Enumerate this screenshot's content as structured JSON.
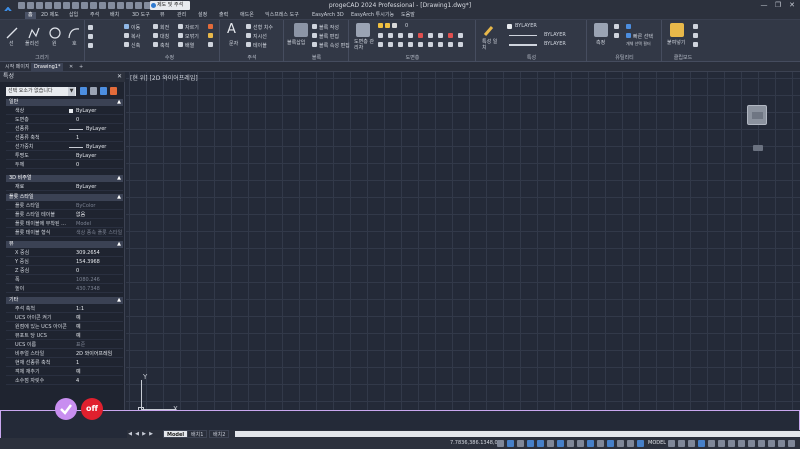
{
  "window": {
    "title": "progeCAD 2024 Professional - [Drawing1.dwg*]",
    "workspace": "제도 및 주석",
    "controls": [
      "—",
      "❐",
      "✕"
    ]
  },
  "menu": {
    "items": [
      "홈",
      "2D 제도",
      "삽입",
      "주석",
      "배치",
      "3D 도구",
      "뷰",
      "관리",
      "설정",
      "출력",
      "애드온",
      "익스프레스 도구",
      "EasyArch 3D",
      "EasyArch 투시기능",
      "도움말"
    ],
    "active": "홈"
  },
  "ribbon": {
    "draw": {
      "label": "그리기",
      "buttons": [
        "선",
        "폴리선",
        "원",
        "호"
      ]
    },
    "modify": {
      "label": "수정",
      "buttons": [
        "이동",
        "회전",
        "자르기",
        "복사",
        "대칭",
        "모깎기",
        "신축",
        "축척",
        "배열"
      ]
    },
    "annotation": {
      "label": "주석",
      "text_label": "문자",
      "buttons": [
        "선형 치수",
        "지시선",
        "테이블"
      ]
    },
    "block": {
      "label": "블록",
      "buttons": [
        "블록삽입",
        "블록 작성",
        "블록 편집",
        "블록 속성 편집"
      ]
    },
    "layers": {
      "label": "도면층",
      "manager_label": "도면층 관리자",
      "current_layer": "0"
    },
    "properties": {
      "label": "특성",
      "match_label": "특성 일치",
      "color": "BYLAYER",
      "linetype": "BYLAYER",
      "lineweight": "BYLAYER"
    },
    "utilities": {
      "label": "유틸리티",
      "buttons": [
        "측정",
        "빠른 선택",
        "개체 선택 필터"
      ]
    },
    "clipboard": {
      "label": "클립보드",
      "paste_label": "붙여넣기"
    }
  },
  "doc_tabs": [
    "시작 페이지",
    "Drawing1*"
  ],
  "properties_palette": {
    "title": "특성",
    "selection": "선택 요소가 없습니다",
    "sections": [
      {
        "name": "일반",
        "rows": [
          {
            "k": "색상",
            "v": "ByLayer",
            "swatch": true
          },
          {
            "k": "도면층",
            "v": "0"
          },
          {
            "k": "선종류",
            "v": "ByLayer",
            "line": true
          },
          {
            "k": "선종류 축척",
            "v": "1"
          },
          {
            "k": "선가중치",
            "v": "ByLayer",
            "line": true
          },
          {
            "k": "투명도",
            "v": "ByLayer"
          },
          {
            "k": "두께",
            "v": "0"
          }
        ]
      },
      {
        "name": "3D 비주얼",
        "rows": [
          {
            "k": "재료",
            "v": "ByLayer"
          }
        ]
      },
      {
        "name": "플롯 스타일",
        "rows": [
          {
            "k": "플롯 스타일",
            "v": "ByColor",
            "dim": true
          },
          {
            "k": "플롯 스타일 테이블",
            "v": "없음"
          },
          {
            "k": "플롯 테이블에 부착된 ...",
            "v": "Model",
            "dim": true
          },
          {
            "k": "플롯 테이블 형식",
            "v": "색상 종속 플롯 스타일",
            "dim": true
          }
        ]
      },
      {
        "name": "뷰",
        "rows": [
          {
            "k": "X 중심",
            "v": "309.2654"
          },
          {
            "k": "Y 중심",
            "v": "154.3968"
          },
          {
            "k": "Z 중심",
            "v": "0"
          },
          {
            "k": "폭",
            "v": "1080.246",
            "dim": true
          },
          {
            "k": "높이",
            "v": "430.7348",
            "dim": true
          }
        ]
      },
      {
        "name": "기타",
        "rows": [
          {
            "k": "주석 축척",
            "v": "1:1"
          },
          {
            "k": "UCS 아이콘 켜기",
            "v": "예"
          },
          {
            "k": "원점에 있는 UCS 아이콘",
            "v": "예"
          },
          {
            "k": "뷰포트 당 UCS",
            "v": "예"
          },
          {
            "k": "UCS 이름",
            "v": "표준",
            "dim": true
          },
          {
            "k": "비주얼 스타일",
            "v": "2D 와이어프레임"
          },
          {
            "k": "현재 선종류 축척",
            "v": "1"
          },
          {
            "k": "객체 재추기",
            "v": "예"
          },
          {
            "k": "소수점 자릿수",
            "v": "4"
          }
        ]
      }
    ]
  },
  "canvas": {
    "view_label": "[현 위] [2D 와이어프레임]",
    "axis_y": "Y",
    "axis_x": "X"
  },
  "overlay": {
    "off_label": "off",
    "check_icon": "check-icon"
  },
  "layout_tabs": {
    "nav": [
      "◀",
      "◀",
      "▶",
      "▶"
    ],
    "tabs": [
      "Model",
      "배치1",
      "배치2"
    ],
    "active": "Model"
  },
  "status_bar": {
    "coordinates": "7.7836,386.1348,0",
    "model_label": "MODEL"
  },
  "colors": {
    "accent": "#4c8ee0",
    "overlay_border": "#c9a7ef",
    "off_red": "#e0202e",
    "check_purple": "#c88ef0"
  }
}
